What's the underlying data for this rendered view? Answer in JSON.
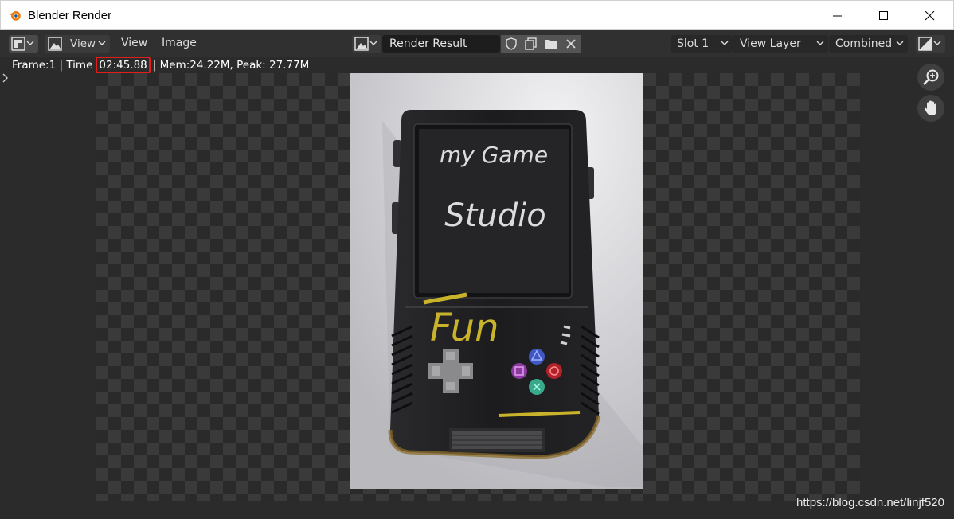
{
  "window": {
    "title": "Blender Render",
    "controls": {
      "minimize": "—",
      "maximize": "☐",
      "close": "✕"
    }
  },
  "header": {
    "editor_type_icon": "image-editor-icon",
    "view_dropdown_label": "View",
    "menus": [
      "View",
      "Image"
    ],
    "image_name": "Render Result",
    "slot": "Slot 1",
    "view_layer": "View Layer",
    "pass": "Combined"
  },
  "status": {
    "prefix": "Frame:1 | Time",
    "time": "02:45.88",
    "suffix": "| Mem:24.22M, Peak: 27.77M"
  },
  "render_image": {
    "screen_line1": "my Game",
    "screen_line2": "Studio",
    "body_text": "Fun"
  },
  "watermark": "https://blog.csdn.net/linjf520",
  "colors": {
    "highlight": "#e51c1c",
    "header_bg": "#303030"
  }
}
